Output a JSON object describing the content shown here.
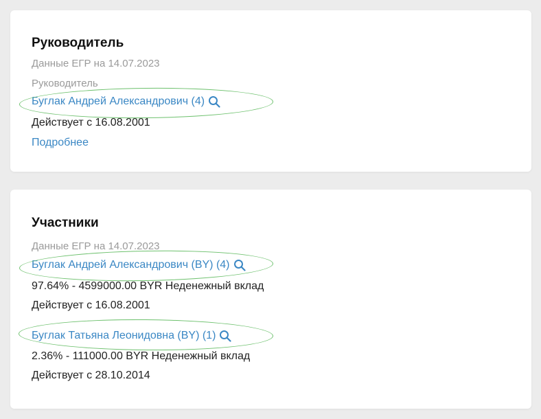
{
  "director": {
    "title": "Руководитель",
    "source": "Данные ЕГР на 14.07.2023",
    "role": "Руководитель",
    "name": "Буглак Андрей Александрович (4)",
    "since": "Действует с 16.08.2001",
    "more_link": "Подробнее"
  },
  "participants": {
    "title": "Участники",
    "source": "Данные ЕГР на 14.07.2023",
    "items": [
      {
        "name": "Буглак Андрей Александрович (BY) (4)",
        "share": "97.64% - 4599000.00 BYR Неденежный вклад",
        "since": "Действует с 16.08.2001"
      },
      {
        "name": "Буглак Татьяна Леонидовна (BY) (1)",
        "share": "2.36% - 111000.00 BYR Неденежный вклад",
        "since": "Действует с 28.10.2014"
      }
    ]
  },
  "colors": {
    "link": "#3a87c4",
    "highlight": "#6cc06c",
    "muted": "#9a9a9a"
  },
  "icons": {
    "search": "search-icon"
  }
}
